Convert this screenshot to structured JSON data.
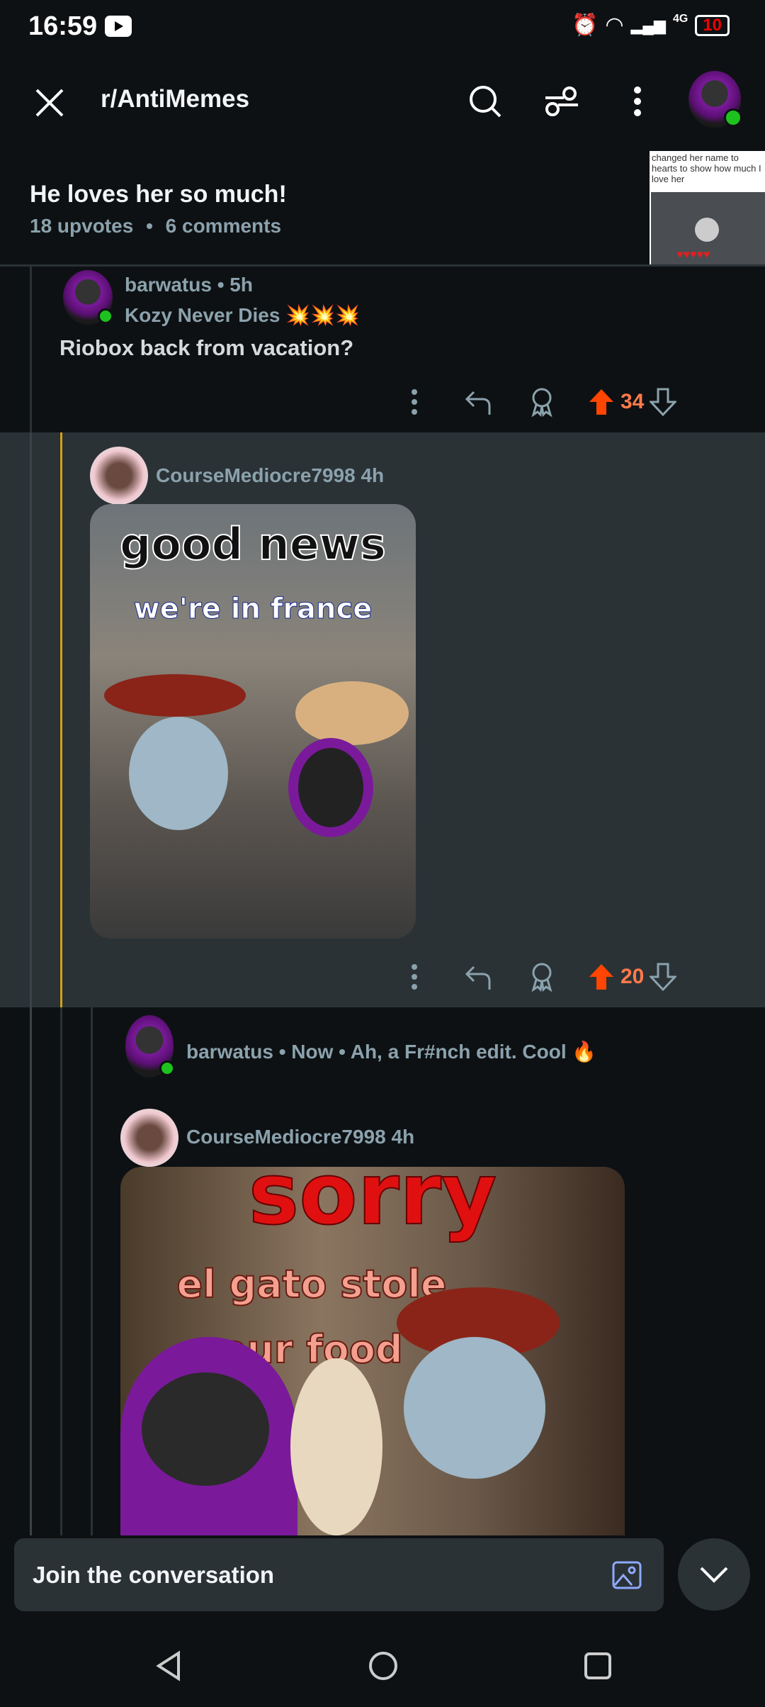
{
  "status_bar": {
    "time": "16:59",
    "network": "4G",
    "battery": "10"
  },
  "header": {
    "subreddit": "r/AntiMemes",
    "icons": [
      "close-icon",
      "search-icon",
      "filter-icon",
      "more-icon",
      "avatar"
    ]
  },
  "post": {
    "title": "He loves her so much!",
    "upvotes": "18 upvotes",
    "comments": "6 comments",
    "separator": "•",
    "thumbnail_caption": "changed her name to hearts to show how much I love her"
  },
  "comments": [
    {
      "user": "barwatus",
      "time": "• 5h",
      "flair": "Kozy Never Dies 💥💥💥",
      "body": "Riobox back from vacation?",
      "score": "34",
      "vote": "up"
    },
    {
      "user": "CourseMediocre7998",
      "time": "4h",
      "meme_top": "good news",
      "meme_sub": "we're in france",
      "score": "20",
      "vote": "up",
      "highlighted": true
    },
    {
      "user": "barwatus",
      "inline": "• Now • Ah, a Fr#nch edit. Cool 🔥"
    },
    {
      "user": "CourseMediocre7998",
      "time": "4h",
      "meme_top": "sorry",
      "meme_sub": "el gato stole our food"
    }
  ],
  "composer": {
    "placeholder": "Join the conversation"
  },
  "colors": {
    "background": "#0e1113",
    "highlight": "#2a3236",
    "upvote": "#ff4500",
    "score": "#ff7a4a",
    "meta": "#8ba2ad",
    "thread_accent": "#d4a017"
  }
}
